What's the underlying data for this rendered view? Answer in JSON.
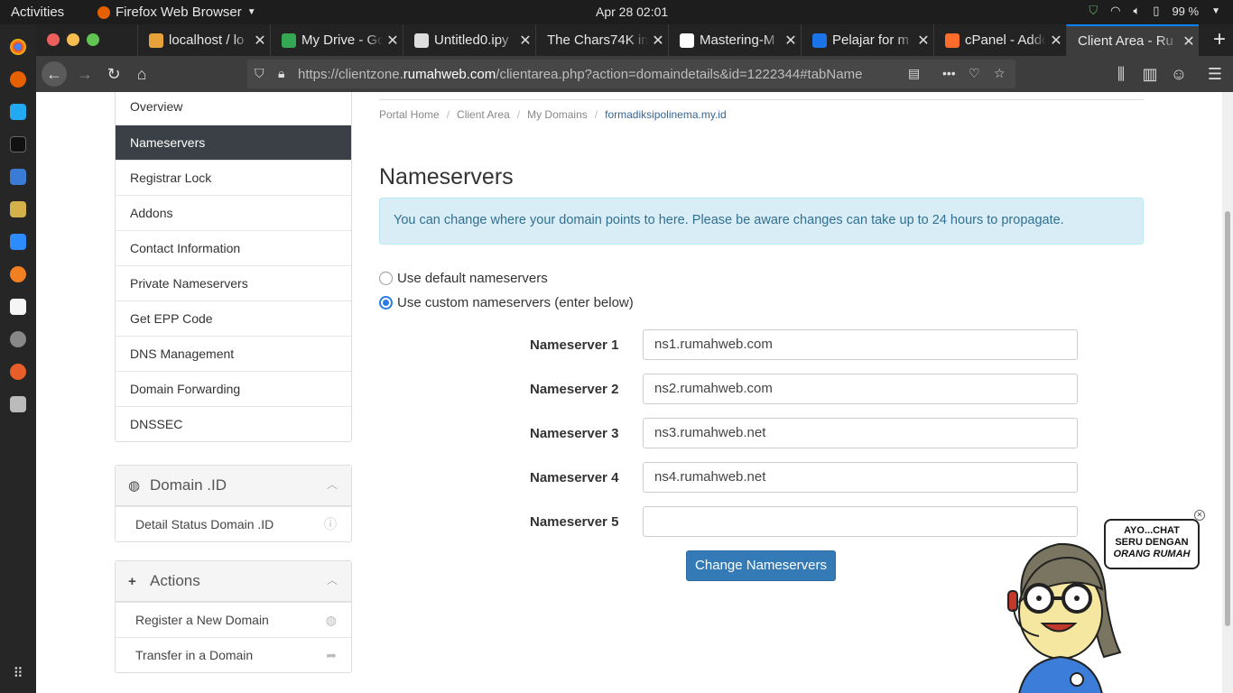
{
  "system": {
    "activities": "Activities",
    "app_name": "Firefox Web Browser",
    "clock": "Apr 28  02:01",
    "battery": "99 %"
  },
  "browser": {
    "tabs": [
      {
        "title": "localhost / lo",
        "color": "#e8a23a"
      },
      {
        "title": "My Drive - Go",
        "color": "#34a853"
      },
      {
        "title": "Untitled0.ipy",
        "color": "#dddddd"
      },
      {
        "title": "The Chars74K im",
        "color": "#3d3d3d"
      },
      {
        "title": "Mastering-M",
        "color": "#ffffff"
      },
      {
        "title": "Pelajar for m",
        "color": "#1a73e8"
      },
      {
        "title": "cPanel - Addo",
        "color": "#ff6c2c"
      },
      {
        "title": "Client Area - Ru",
        "color": "#2b5797"
      }
    ],
    "url_prefix": "https://clientzone.",
    "url_domain": "rumahweb.com",
    "url_suffix": "/clientarea.php?action=domaindetails&id=1222344#tabName"
  },
  "sidebar": {
    "menu": [
      "Overview",
      "Nameservers",
      "Registrar Lock",
      "Addons",
      "Contact Information",
      "Private Nameservers",
      "Get EPP Code",
      "DNS Management",
      "Domain Forwarding",
      "DNSSEC"
    ],
    "domain_panel": {
      "title": "Domain .ID",
      "items": [
        "Detail Status Domain .ID"
      ]
    },
    "actions_panel": {
      "title": "Actions",
      "items": [
        "Register a New Domain",
        "Transfer in a Domain"
      ]
    }
  },
  "breadcrumb": [
    "Portal Home",
    "Client Area",
    "My Domains",
    "formadiksipolinema.my.id"
  ],
  "main": {
    "heading": "Nameservers",
    "alert": "You can change where your domain points to here. Please be aware changes can take up to 24 hours to propagate.",
    "radio_default": "Use default nameservers",
    "radio_custom": "Use custom nameservers (enter below)",
    "nameservers": [
      {
        "label": "Nameserver 1",
        "value": "ns1.rumahweb.com"
      },
      {
        "label": "Nameserver 2",
        "value": "ns2.rumahweb.com"
      },
      {
        "label": "Nameserver 3",
        "value": "ns3.rumahweb.net"
      },
      {
        "label": "Nameserver 4",
        "value": "ns4.rumahweb.net"
      },
      {
        "label": "Nameserver 5",
        "value": ""
      }
    ],
    "submit": "Change Nameservers"
  },
  "chat": {
    "line1": "AYO...CHAT",
    "line2": "SERU DENGAN",
    "line3": "ORANG RUMAH"
  }
}
